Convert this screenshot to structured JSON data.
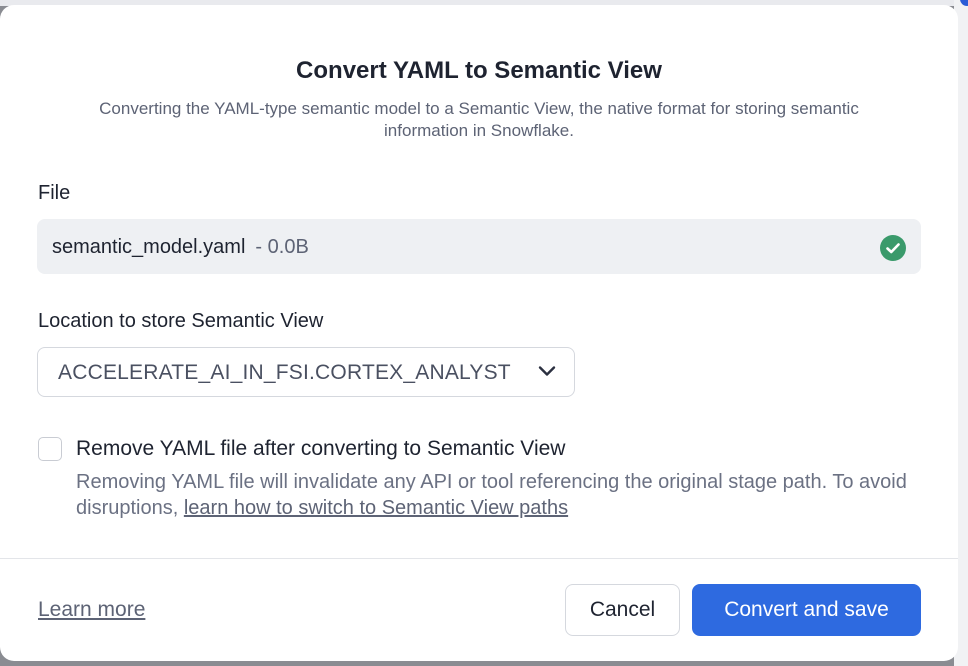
{
  "dialog": {
    "title": "Convert YAML to Semantic View",
    "subtitle": "Converting the YAML-type semantic model to a Semantic View, the native format for storing semantic information in Snowflake."
  },
  "file": {
    "label": "File",
    "name": "semantic_model.yaml",
    "size": "- 0.0B",
    "status_icon": "check-circle-icon",
    "status_color": "#3a9a6b"
  },
  "location": {
    "label": "Location to store Semantic View",
    "selected": "ACCELERATE_AI_IN_FSI.CORTEX_ANALYST"
  },
  "remove_option": {
    "checked": false,
    "label": "Remove YAML file after converting to Semantic View",
    "help_text": "Removing YAML file will invalidate any API or tool referencing the original stage path. To avoid disruptions, ",
    "help_link": "learn how to switch to Semantic View paths"
  },
  "footer": {
    "learn_more": "Learn more",
    "cancel_label": "Cancel",
    "submit_label": "Convert and save"
  },
  "colors": {
    "primary": "#2e6ae0",
    "success": "#3a9a6b"
  }
}
